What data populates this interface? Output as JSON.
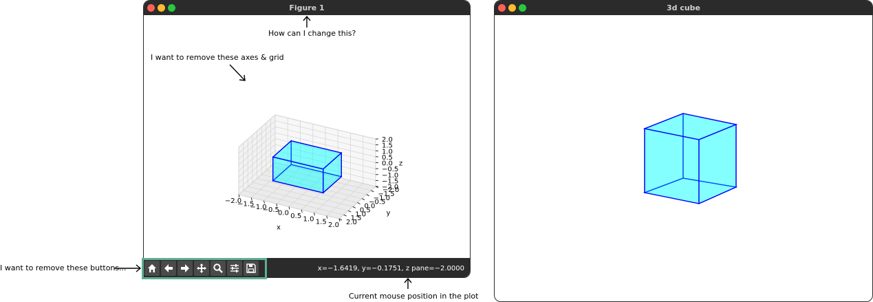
{
  "figure_window": {
    "title": "Figure 1",
    "status": "x=−1.6419, y=−0.1751, z pane=−2.0000",
    "toolbar": [
      {
        "name": "home",
        "icon": "home-icon"
      },
      {
        "name": "back",
        "icon": "arrow-left-icon"
      },
      {
        "name": "forward",
        "icon": "arrow-right-icon"
      },
      {
        "name": "pan",
        "icon": "move-icon"
      },
      {
        "name": "zoom",
        "icon": "search-icon"
      },
      {
        "name": "configure",
        "icon": "sliders-icon"
      },
      {
        "name": "save",
        "icon": "save-icon"
      }
    ],
    "chart_data": {
      "type": "3d-wireframe",
      "xlabel": "x",
      "ylabel": "y",
      "zlabel": "z",
      "xlim": [
        -2.0,
        2.0
      ],
      "ylim": [
        -2.0,
        2.0
      ],
      "zlim": [
        -2.0,
        2.0
      ],
      "ticks": [
        "−2.0",
        "−1.5",
        "−1.0",
        "−0.5",
        "0.0",
        "0.5",
        "1.0",
        "1.5",
        "2.0"
      ],
      "cube": {
        "min": -1,
        "max": 1,
        "face_color": "#00ffff",
        "edge_color": "#0000ff"
      }
    }
  },
  "cube_window": {
    "title": "3d cube"
  },
  "annotations": {
    "title_question": "How can I change this?",
    "remove_axes": "I want to remove these axes & grid",
    "remove_buttons": "I want to remove these buttons...",
    "mouse_position": "Current mouse position in the plot"
  },
  "colors": {
    "titlebar": "#2b2b2b",
    "cube_face": "#00ffff",
    "cube_edge": "#0000ff",
    "toolbar_highlight": "#5fae94"
  }
}
